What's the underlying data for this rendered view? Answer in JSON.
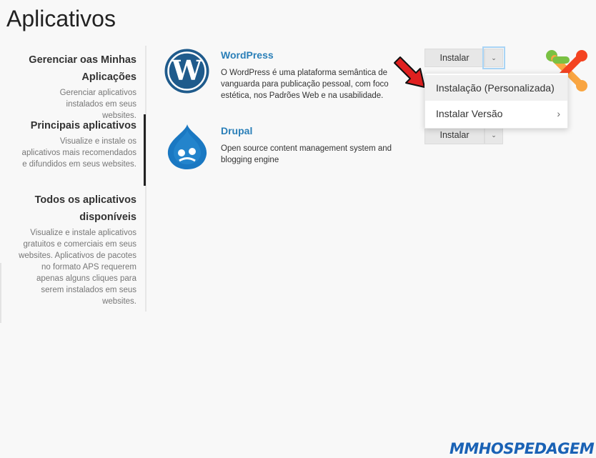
{
  "page": {
    "title": "Aplicativos"
  },
  "sidebar": {
    "items": [
      {
        "title": "Gerenciar oas Minhas Aplicações",
        "description": "Gerenciar aplicativos instalados em seus websites."
      },
      {
        "title": "Principais aplicativos",
        "description": "Visualize e instale os aplicativos mais recomendados e difundidos em seus websites."
      },
      {
        "title": "Todos os aplicativos disponíveis",
        "description": "Visualize e instale aplicativos gratuitos e comerciais em seus websites. Aplicativos de pacotes no formato APS requerem apenas alguns cliques para serem instalados em seus websites."
      }
    ],
    "active_index": 1
  },
  "apps": [
    {
      "name": "WordPress",
      "description": "O WordPress é uma plataforma semântica de vanguarda para publicação pessoal, com foco estética, nos Padrões Web e na usabilidade.",
      "install_label": "Instalar",
      "logo_icon": "wordpress-logo"
    },
    {
      "name": "Drupal",
      "description": "Open source content management system and blogging engine",
      "install_label": "Instalar",
      "logo_icon": "drupal-logo"
    }
  ],
  "dropdown": {
    "items": [
      {
        "label": "Instalação (Personalizada)"
      },
      {
        "label": "Instalar Versão",
        "has_submenu": true
      }
    ]
  },
  "watermark": {
    "text": "MMHOSPEDAGEM"
  },
  "colors": {
    "link": "#2a7fb8",
    "arrow": "#e02020",
    "watermark": "#1a62b5"
  }
}
